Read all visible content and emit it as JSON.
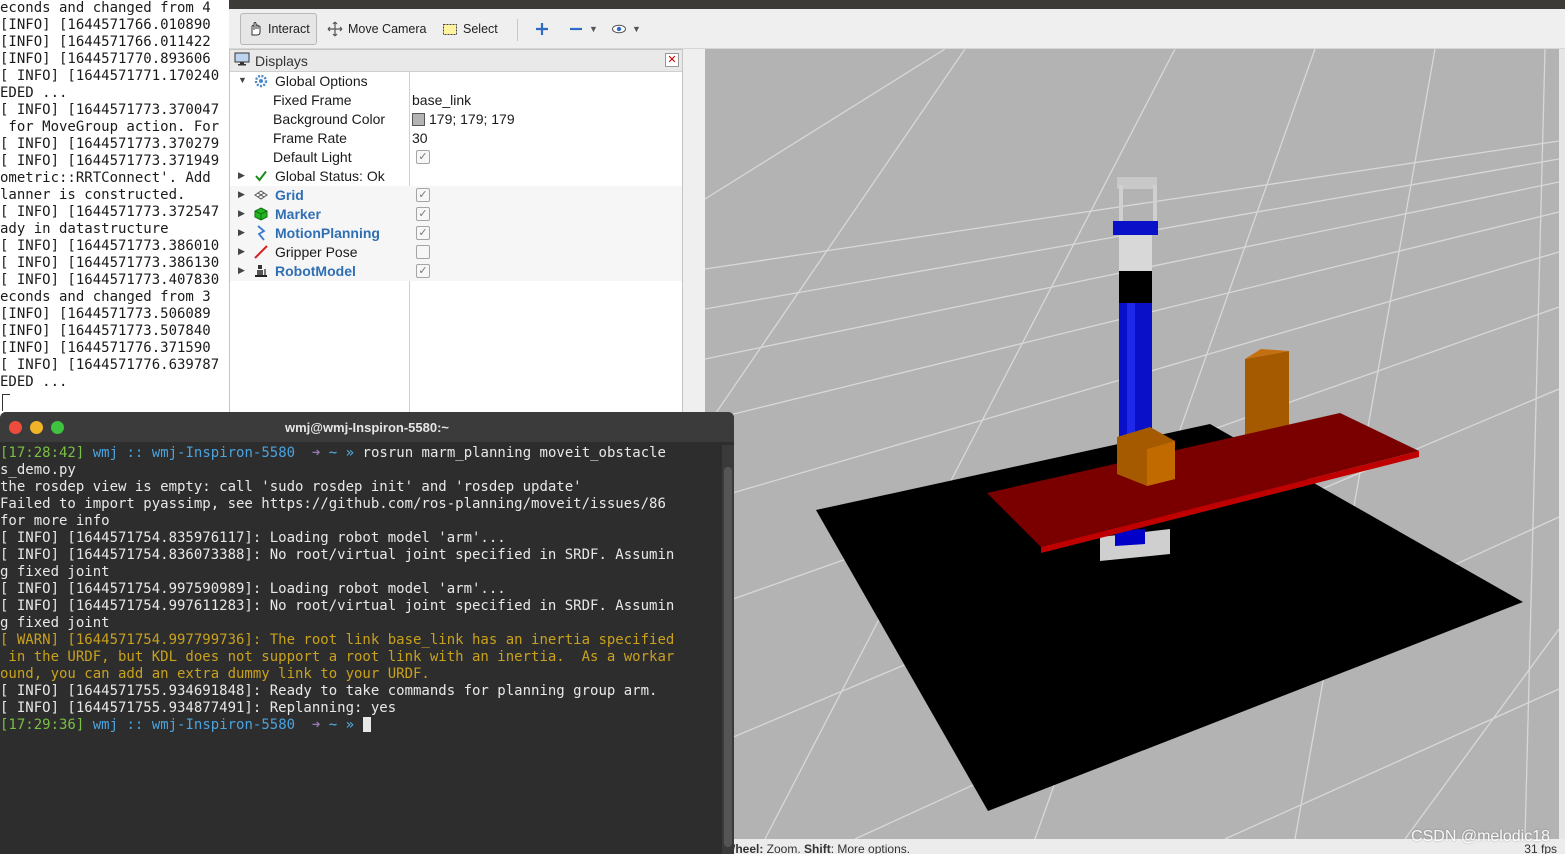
{
  "background_terminal": {
    "lines": [
      "econds and changed from 4",
      "[INFO] [1644571766.010890",
      "[INFO] [1644571766.011422",
      "[INFO] [1644571770.893606",
      "[ INFO] [1644571771.170240",
      "EDED ...",
      "[ INFO] [1644571773.370047",
      " for MoveGroup action. For",
      "[ INFO] [1644571773.370279",
      "[ INFO] [1644571773.371949",
      "ometric::RRTConnect'. Add",
      "lanner is constructed.",
      "[ INFO] [1644571773.372547",
      "ady in datastructure",
      "[ INFO] [1644571773.386010",
      "[ INFO] [1644571773.386130",
      "[ INFO] [1644571773.407830",
      "econds and changed from 3",
      "[INFO] [1644571773.506089",
      "[INFO] [1644571773.507840",
      "[INFO] [1644571776.371590",
      "[ INFO] [1644571776.639787",
      "EDED ..."
    ]
  },
  "rviz": {
    "toolbar": {
      "interact": "Interact",
      "move_camera": "Move Camera",
      "select": "Select"
    },
    "displays": {
      "title": "Displays",
      "global_options": "Global Options",
      "properties": [
        {
          "name": "Fixed Frame",
          "value": "base_link"
        },
        {
          "name": "Background Color",
          "value": "179; 179; 179"
        },
        {
          "name": "Frame Rate",
          "value": "30"
        },
        {
          "name": "Default Light",
          "value": ""
        }
      ],
      "global_status": "Global Status: Ok",
      "items": [
        {
          "name": "Grid",
          "checked": true
        },
        {
          "name": "Marker",
          "checked": true
        },
        {
          "name": "MotionPlanning",
          "checked": true
        },
        {
          "name": "Gripper Pose",
          "checked": false
        },
        {
          "name": "RobotModel",
          "checked": true
        }
      ]
    },
    "statusbar": {
      "hint_bold1": "Wheel:",
      "hint1": " Zoom. ",
      "hint_bold2": "Shift",
      "hint2": ": More options.",
      "fps": "31 fps"
    },
    "colors": {
      "background": "#b3b3b3",
      "table": "#000000",
      "tray": "#7a0000",
      "block": "#a65a00",
      "arm": "#0a10c8"
    }
  },
  "terminal": {
    "title": "wmj@wmj-Inspiron-5580:~",
    "prompt1": {
      "time": "[17:28:42]",
      "user": "wmj",
      "sep": "::",
      "host": "wmj-Inspiron-5580",
      "arrow": "➜",
      "dir": "~",
      "ps": "»",
      "command": "rosrun marm_planning moveit_obstacle"
    },
    "lines": [
      {
        "text": "s_demo.py",
        "kind": "normal"
      },
      {
        "text": "the rosdep view is empty: call 'sudo rosdep init' and 'rosdep update'",
        "kind": "normal"
      },
      {
        "text": "Failed to import pyassimp, see https://github.com/ros-planning/moveit/issues/86",
        "kind": "normal"
      },
      {
        "text": "for more info",
        "kind": "normal"
      },
      {
        "text": "[ INFO] [1644571754.835976117]: Loading robot model 'arm'...",
        "kind": "normal"
      },
      {
        "text": "[ INFO] [1644571754.836073388]: No root/virtual joint specified in SRDF. Assumin",
        "kind": "normal"
      },
      {
        "text": "g fixed joint",
        "kind": "normal"
      },
      {
        "text": "[ INFO] [1644571754.997590989]: Loading robot model 'arm'...",
        "kind": "normal"
      },
      {
        "text": "[ INFO] [1644571754.997611283]: No root/virtual joint specified in SRDF. Assumin",
        "kind": "normal"
      },
      {
        "text": "g fixed joint",
        "kind": "normal"
      },
      {
        "text": "[ WARN] [1644571754.997799736]: The root link base_link has an inertia specified",
        "kind": "warn"
      },
      {
        "text": " in the URDF, but KDL does not support a root link with an inertia.  As a workar",
        "kind": "warn"
      },
      {
        "text": "ound, you can add an extra dummy link to your URDF.",
        "kind": "warn"
      },
      {
        "text": "[ INFO] [1644571755.934691848]: Ready to take commands for planning group arm.",
        "kind": "normal"
      },
      {
        "text": "[ INFO] [1644571755.934877491]: Replanning: yes",
        "kind": "normal"
      }
    ],
    "prompt2": {
      "time": "[17:29:36]",
      "user": "wmj",
      "sep": "::",
      "host": "wmj-Inspiron-5580",
      "arrow": "➜",
      "dir": "~",
      "ps": "»"
    }
  },
  "watermark": "CSDN @melodic18"
}
